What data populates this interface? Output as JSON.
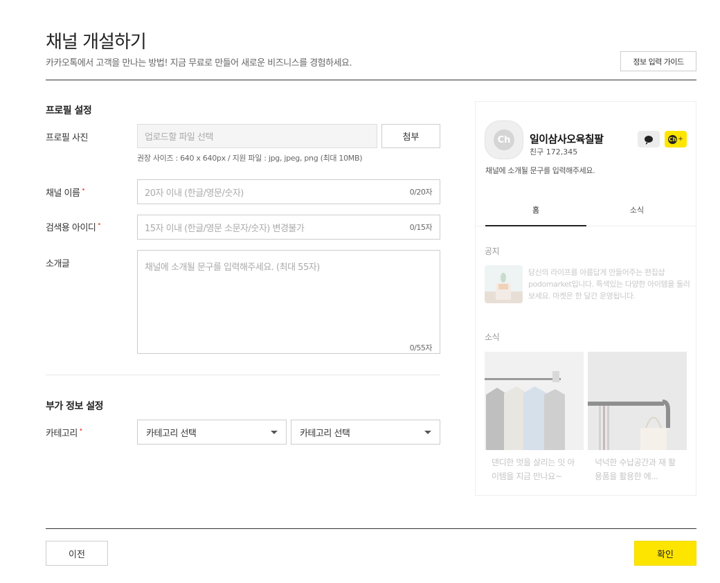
{
  "header": {
    "title": "채널 개설하기",
    "subtitle": "카카오톡에서 고객을 만나는 방법! 지금 무료로 만들어 새로운 비즈니스를 경험하세요.",
    "guide_button": "정보 입력 가이드"
  },
  "profile": {
    "section_title": "프로필 설정",
    "photo_label": "프로필 사진",
    "photo_placeholder": "업로드할 파일 선택",
    "attach_button": "첨부",
    "photo_hint": "권장 사이즈 : 640 x 640px / 지원 파일 : jpg, jpeg, png (최대 10MB)",
    "name_label": "채널 이름",
    "name_placeholder": "20자 이내 (한글/영문/숫자)",
    "name_counter": "0/20자",
    "id_label": "검색용 아이디",
    "id_placeholder": "15자 이내 (한글/영문 소문자/숫자) 변경불가",
    "id_counter": "0/15자",
    "intro_label": "소개글",
    "intro_placeholder": "채널에 소개될 문구를 입력해주세요. (최대 55자)",
    "intro_counter": "0/55자",
    "required_mark": "•"
  },
  "extra": {
    "section_title": "부가 정보 설정",
    "category_label": "카테고리",
    "category_select_1": "카테고리 선택",
    "category_select_2": "카테고리 선택"
  },
  "preview": {
    "logo_text": "Ch",
    "channel_name": "일이삼사오육칠팔",
    "friends": "친구 172,345",
    "description": "채널에 소개될 문구를 입력해주세요.",
    "add_badge": "Ch",
    "add_plus": "+",
    "tabs": [
      "홈",
      "소식"
    ],
    "notice_title": "공지",
    "notice_text": "당신의 라이프를 아름답게 만들어주는 편집샵 podomarket입니다. 특색있는 다양한 아이템을 둘러보세요. 마켓은 한 달간 운영됩니다.",
    "news_title": "소식",
    "news": [
      {
        "text": "댄디한 멋을 살리는 잇 아이템을 지금 만나요~"
      },
      {
        "text": "넉넉한 수납공간과 재 활용품을 활용한 에..."
      }
    ]
  },
  "footer": {
    "prev_button": "이전",
    "confirm_button": "확인"
  },
  "colors": {
    "accent": "#fee500",
    "required": "#f15746"
  }
}
